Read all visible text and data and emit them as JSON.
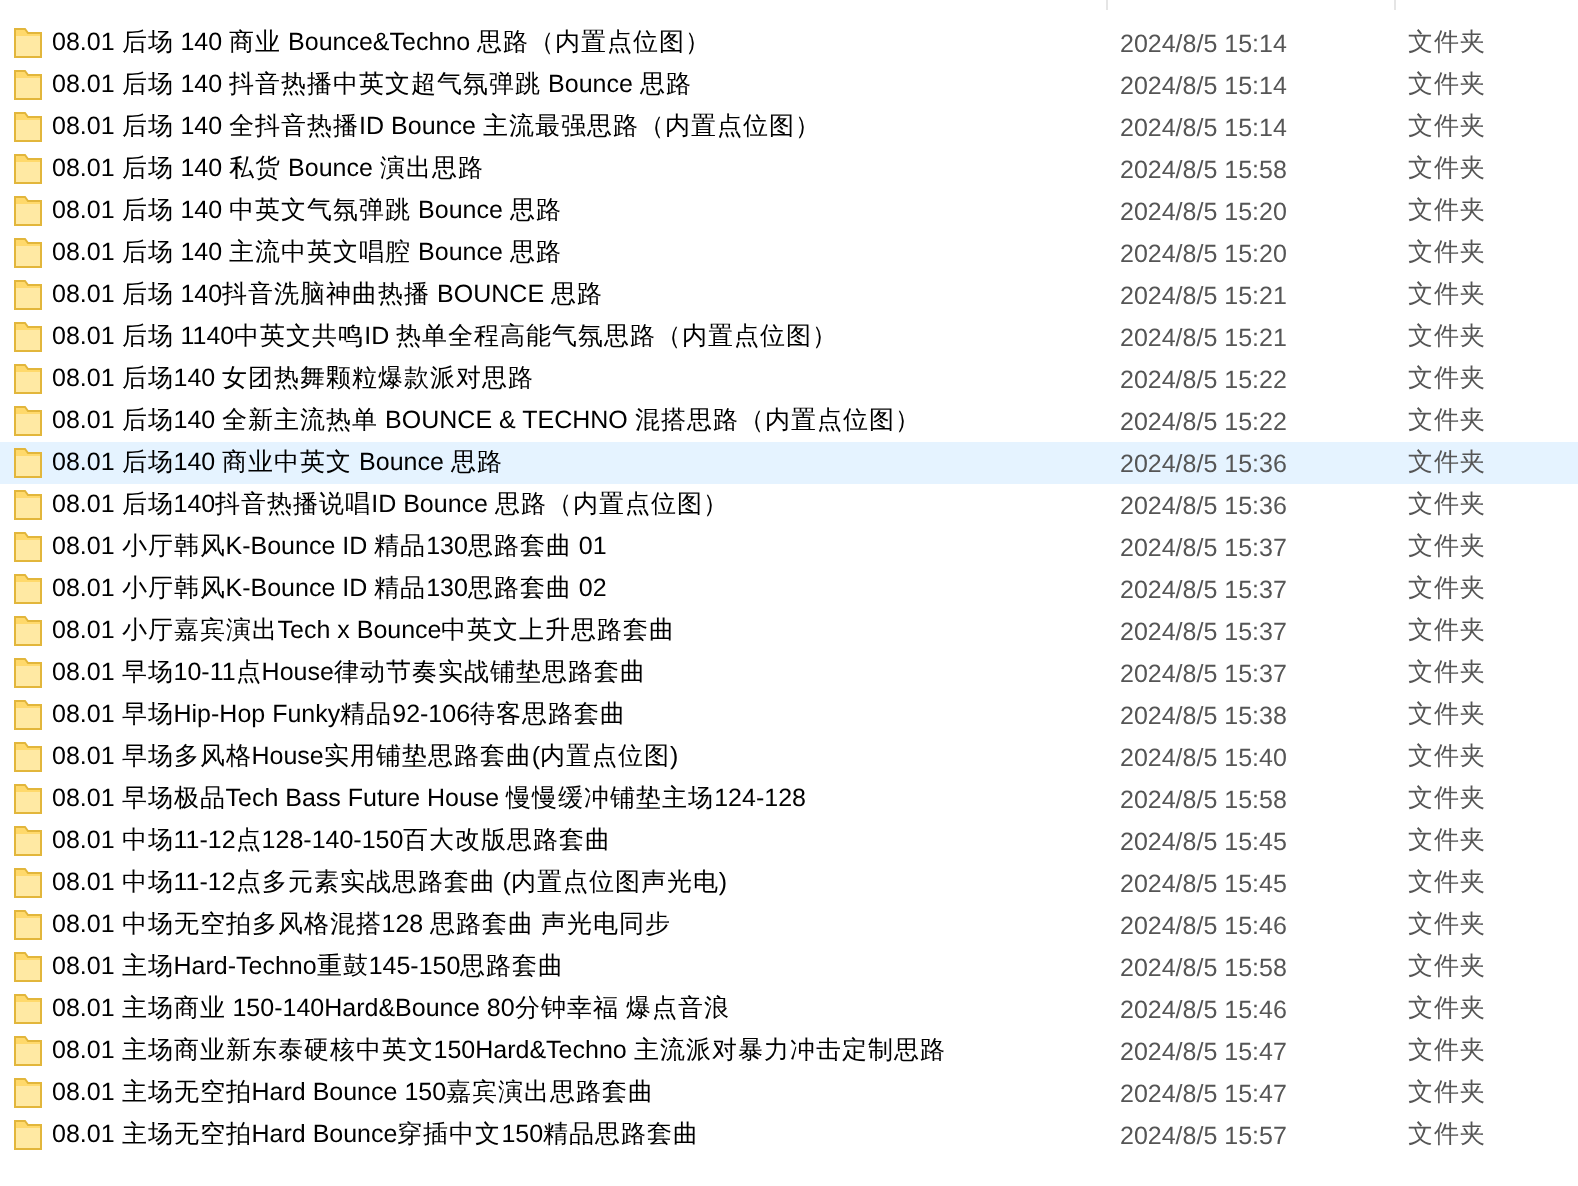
{
  "files": [
    {
      "name": "08.01 后场  140 商业 Bounce&Techno 思路（内置点位图）",
      "modified": "2024/8/5 15:14",
      "type": "文件夹",
      "selected": false
    },
    {
      "name": "08.01 后场 140 抖音热播中英文超气氛弹跳 Bounce 思路",
      "modified": "2024/8/5 15:14",
      "type": "文件夹",
      "selected": false
    },
    {
      "name": "08.01 后场 140 全抖音热播ID Bounce 主流最强思路（内置点位图）",
      "modified": "2024/8/5 15:14",
      "type": "文件夹",
      "selected": false
    },
    {
      "name": "08.01 后场 140 私货 Bounce 演出思路",
      "modified": "2024/8/5 15:58",
      "type": "文件夹",
      "selected": false
    },
    {
      "name": "08.01 后场 140 中英文气氛弹跳 Bounce 思路",
      "modified": "2024/8/5 15:20",
      "type": "文件夹",
      "selected": false
    },
    {
      "name": "08.01 后场 140 主流中英文唱腔 Bounce 思路",
      "modified": "2024/8/5 15:20",
      "type": "文件夹",
      "selected": false
    },
    {
      "name": "08.01 后场 140抖音洗脑神曲热播 BOUNCE 思路",
      "modified": "2024/8/5 15:21",
      "type": "文件夹",
      "selected": false
    },
    {
      "name": "08.01 后场 1140中英文共鸣ID 热单全程高能气氛思路（内置点位图）",
      "modified": "2024/8/5 15:21",
      "type": "文件夹",
      "selected": false
    },
    {
      "name": "08.01 后场140 女团热舞颗粒爆款派对思路",
      "modified": "2024/8/5 15:22",
      "type": "文件夹",
      "selected": false
    },
    {
      "name": "08.01 后场140 全新主流热单 BOUNCE & TECHNO 混搭思路（内置点位图）",
      "modified": "2024/8/5 15:22",
      "type": "文件夹",
      "selected": false
    },
    {
      "name": "08.01 后场140 商业中英文 Bounce 思路",
      "modified": "2024/8/5 15:36",
      "type": "文件夹",
      "selected": true
    },
    {
      "name": "08.01 后场140抖音热播说唱ID Bounce 思路（内置点位图）",
      "modified": "2024/8/5 15:36",
      "type": "文件夹",
      "selected": false
    },
    {
      "name": "08.01 小厅韩风K-Bounce ID  精品130思路套曲 01",
      "modified": "2024/8/5 15:37",
      "type": "文件夹",
      "selected": false
    },
    {
      "name": "08.01 小厅韩风K-Bounce ID  精品130思路套曲 02",
      "modified": "2024/8/5 15:37",
      "type": "文件夹",
      "selected": false
    },
    {
      "name": "08.01 小厅嘉宾演出Tech x Bounce中英文上升思路套曲",
      "modified": "2024/8/5 15:37",
      "type": "文件夹",
      "selected": false
    },
    {
      "name": "08.01 早场10-11点House律动节奏实战铺垫思路套曲",
      "modified": "2024/8/5 15:37",
      "type": "文件夹",
      "selected": false
    },
    {
      "name": "08.01 早场Hip-Hop Funky精品92-106待客思路套曲",
      "modified": "2024/8/5 15:38",
      "type": "文件夹",
      "selected": false
    },
    {
      "name": "08.01 早场多风格House实用铺垫思路套曲(内置点位图)",
      "modified": "2024/8/5 15:40",
      "type": "文件夹",
      "selected": false
    },
    {
      "name": "08.01 早场极品Tech Bass Future House 慢慢缓冲铺垫主场124-128",
      "modified": "2024/8/5 15:58",
      "type": "文件夹",
      "selected": false
    },
    {
      "name": "08.01 中场11-12点128-140-150百大改版思路套曲",
      "modified": "2024/8/5 15:45",
      "type": "文件夹",
      "selected": false
    },
    {
      "name": "08.01 中场11-12点多元素实战思路套曲 (内置点位图声光电)",
      "modified": "2024/8/5 15:45",
      "type": "文件夹",
      "selected": false
    },
    {
      "name": "08.01 中场无空拍多风格混搭128 思路套曲 声光电同步",
      "modified": "2024/8/5 15:46",
      "type": "文件夹",
      "selected": false
    },
    {
      "name": "08.01 主场Hard-Techno重鼓145-150思路套曲",
      "modified": "2024/8/5 15:58",
      "type": "文件夹",
      "selected": false
    },
    {
      "name": "08.01 主场商业 150-140Hard&Bounce  80分钟幸福 爆点音浪",
      "modified": "2024/8/5 15:46",
      "type": "文件夹",
      "selected": false
    },
    {
      "name": "08.01 主场商业新东泰硬核中英文150Hard&Techno 主流派对暴力冲击定制思路",
      "modified": "2024/8/5 15:47",
      "type": "文件夹",
      "selected": false
    },
    {
      "name": "08.01 主场无空拍Hard Bounce 150嘉宾演出思路套曲",
      "modified": "2024/8/5 15:47",
      "type": "文件夹",
      "selected": false
    },
    {
      "name": "08.01 主场无空拍Hard Bounce穿插中文150精品思路套曲",
      "modified": "2024/8/5 15:57",
      "type": "文件夹",
      "selected": false
    }
  ]
}
